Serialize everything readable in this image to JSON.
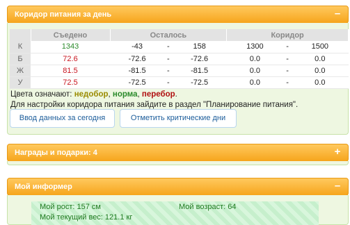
{
  "corridor_panel": {
    "title": "Коридор питания за день",
    "toggle": "–",
    "columns": [
      "Съедено",
      "Осталось",
      "Коридор"
    ],
    "rows": [
      {
        "label": "К",
        "eaten": "1343",
        "eaten_color": "green",
        "left_from": "-43",
        "left_sep": "-",
        "left_to": "158",
        "cor_from": "1300",
        "cor_sep": "-",
        "cor_to": "1500"
      },
      {
        "label": "Б",
        "eaten": "72.6",
        "eaten_color": "red",
        "left_from": "-72.6",
        "left_sep": "-",
        "left_to": "-72.6",
        "cor_from": "0.0",
        "cor_sep": "-",
        "cor_to": "0.0"
      },
      {
        "label": "Ж",
        "eaten": "81.5",
        "eaten_color": "red",
        "left_from": "-81.5",
        "left_sep": "-",
        "left_to": "-81.5",
        "cor_from": "0.0",
        "cor_sep": "-",
        "cor_to": "0.0"
      },
      {
        "label": "У",
        "eaten": "72.5",
        "eaten_color": "red",
        "left_from": "-72.5",
        "left_sep": "-",
        "left_to": "-72.5",
        "cor_from": "0.0",
        "cor_sep": "-",
        "cor_to": "0.0"
      }
    ],
    "legend_prefix": "Цвета означают: ",
    "legend_under": "недобор",
    "legend_norm": "норма",
    "legend_over": "перебор",
    "legend_sep": ", ",
    "legend_end": ".",
    "hint": "Для настройки коридора питания зайдите в раздел \"Планирование питания\".",
    "button_enter_today": "Ввод данных за сегодня",
    "button_mark_critical": "Отметить критические дни",
    "colors": {
      "green": "#2a8a2a",
      "red": "#c8141e",
      "header": "#f6a51c"
    }
  },
  "awards_panel": {
    "title": "Награды и подарки: 4",
    "toggle": "+"
  },
  "informer_panel": {
    "title": "Мой информер",
    "toggle": "–",
    "height_text": "Мой рост: 157 см",
    "age_text": "Мой возраст: 64",
    "weight_text": "Мой текущий вес: 121.1 кг"
  }
}
